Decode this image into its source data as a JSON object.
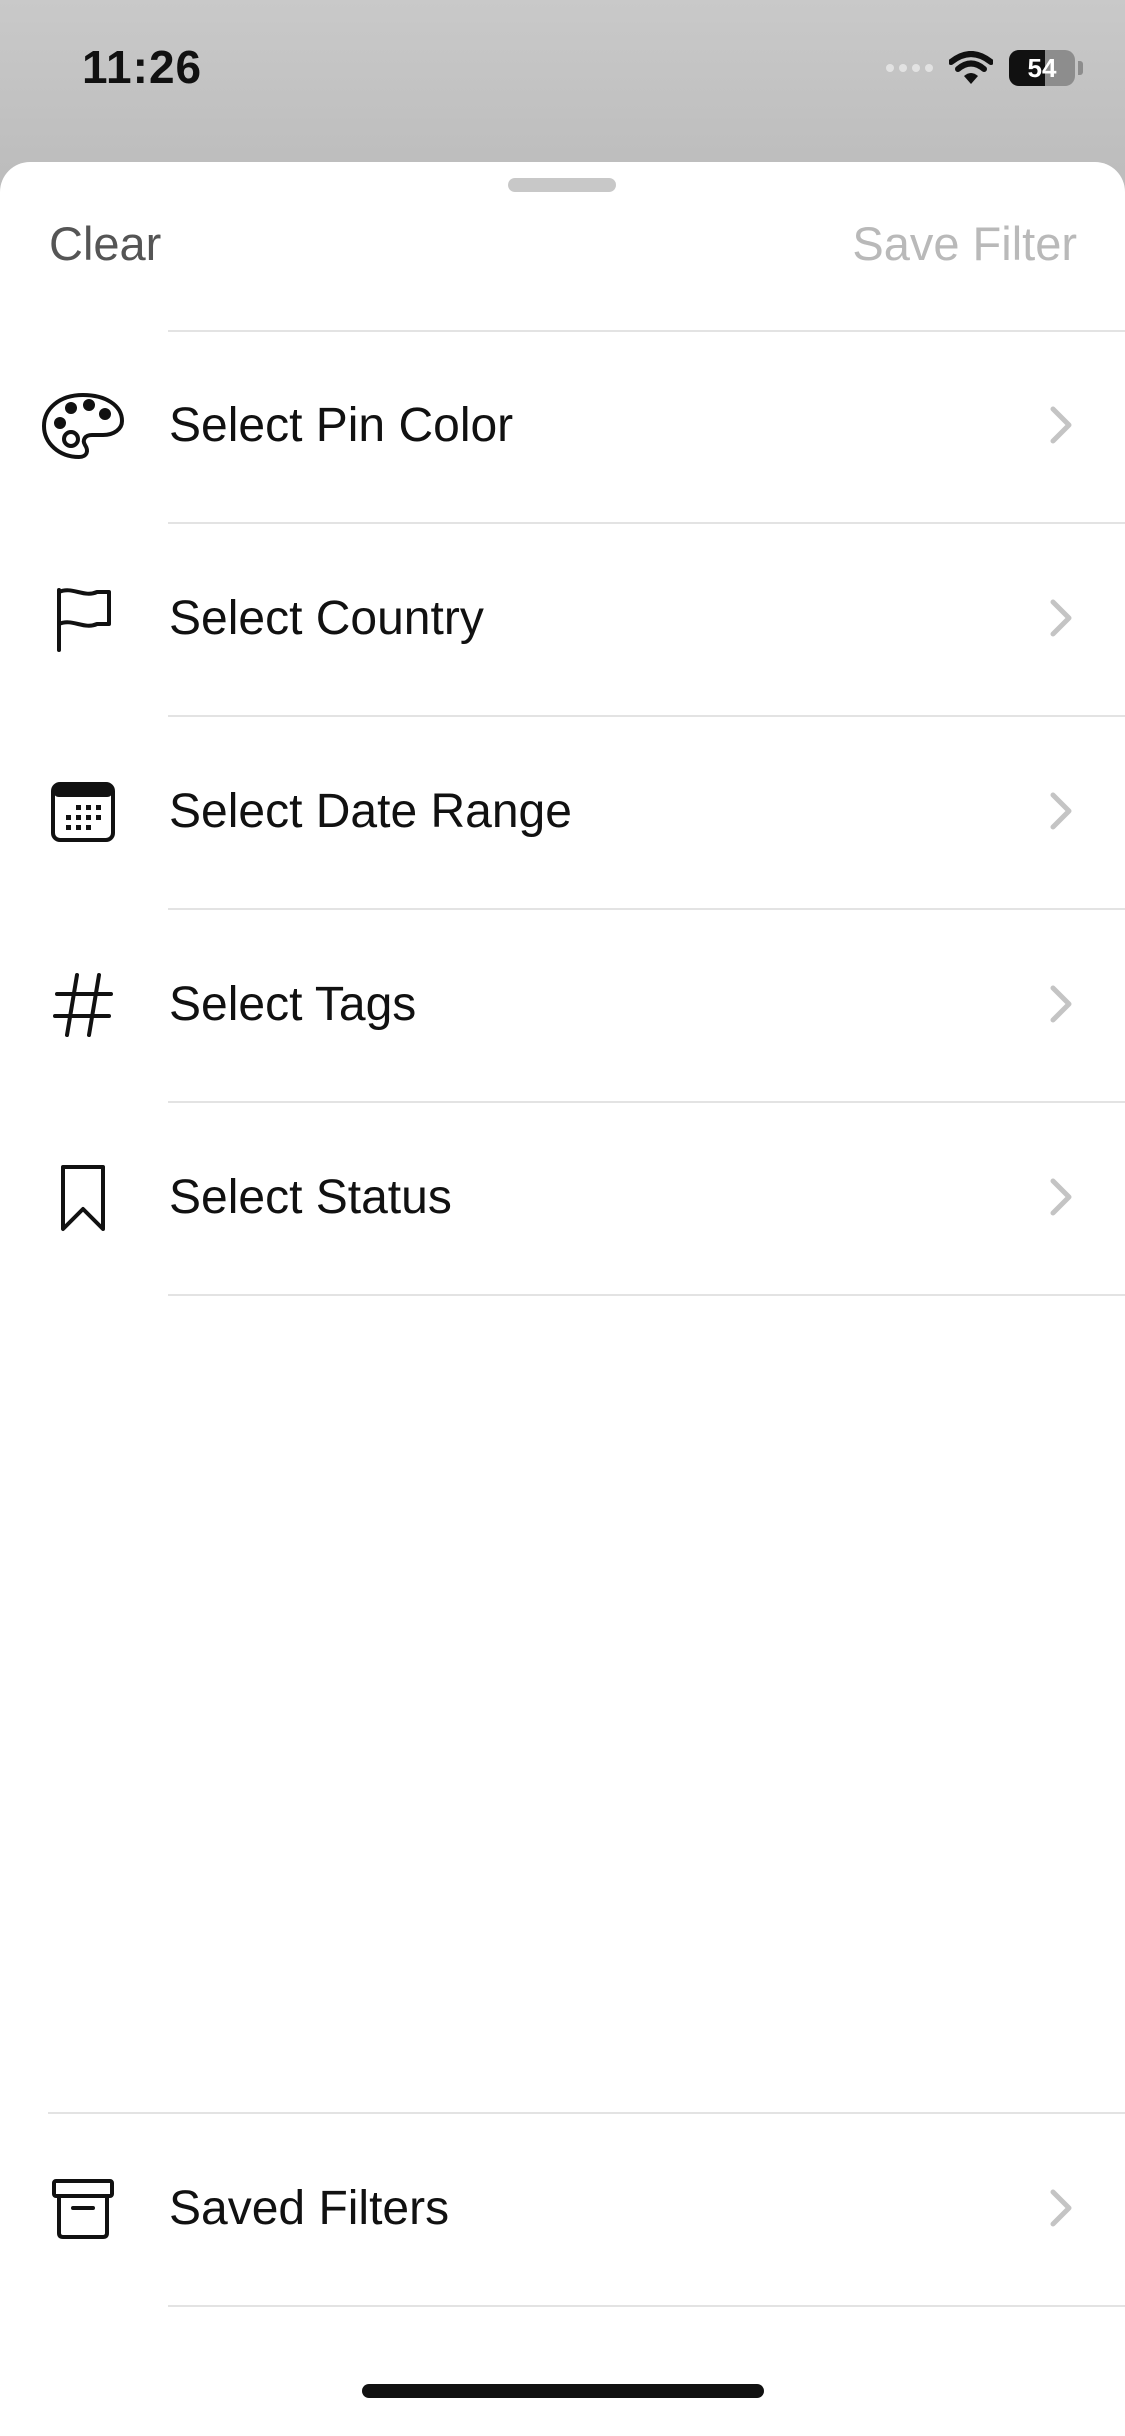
{
  "status_bar": {
    "time": "11:26",
    "battery_level": "54",
    "icons": [
      "cellular-signal-icon",
      "wifi-icon",
      "battery-icon"
    ]
  },
  "sheet": {
    "clear_label": "Clear",
    "save_label": "Save Filter",
    "save_enabled": false
  },
  "filters": [
    {
      "label": "Select Pin Color",
      "icon": "palette-icon"
    },
    {
      "label": "Select Country",
      "icon": "flag-icon"
    },
    {
      "label": "Select Date Range",
      "icon": "calendar-icon"
    },
    {
      "label": "Select Tags",
      "icon": "hashtag-icon"
    },
    {
      "label": "Select Status",
      "icon": "bookmark-icon"
    }
  ],
  "saved_filters": {
    "label": "Saved Filters",
    "icon": "archive-box-icon"
  },
  "colors": {
    "text_primary": "#111111",
    "clear_text": "#555555",
    "save_disabled_text": "#b9b9b9",
    "chevron": "#c4c4c4",
    "divider": "#e3e3e3"
  }
}
